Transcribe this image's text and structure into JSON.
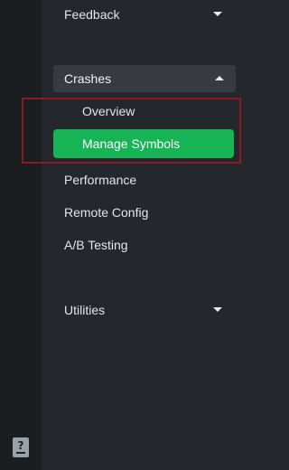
{
  "nav": {
    "feedback_label": "Feedback",
    "crashes_label": "Crashes",
    "crashes_children": {
      "overview_label": "Overview",
      "manage_symbols_label": "Manage Symbols"
    },
    "performance_label": "Performance",
    "remote_config_label": "Remote Config",
    "ab_testing_label": "A/B Testing",
    "utilities_label": "Utilities"
  },
  "rail": {
    "help_glyph": "?"
  },
  "icons": {
    "feedback_toggle": "chevron-down-icon",
    "crashes_toggle": "chevron-up-icon",
    "utilities_toggle": "chevron-down-icon",
    "help": "help-icon"
  },
  "colors": {
    "active_item_bg": "#17b455",
    "highlight_border": "#8b1a22",
    "rail_bg": "#1b1d20",
    "panel_bg": "#24272b",
    "group_header_bg": "#373b40"
  }
}
